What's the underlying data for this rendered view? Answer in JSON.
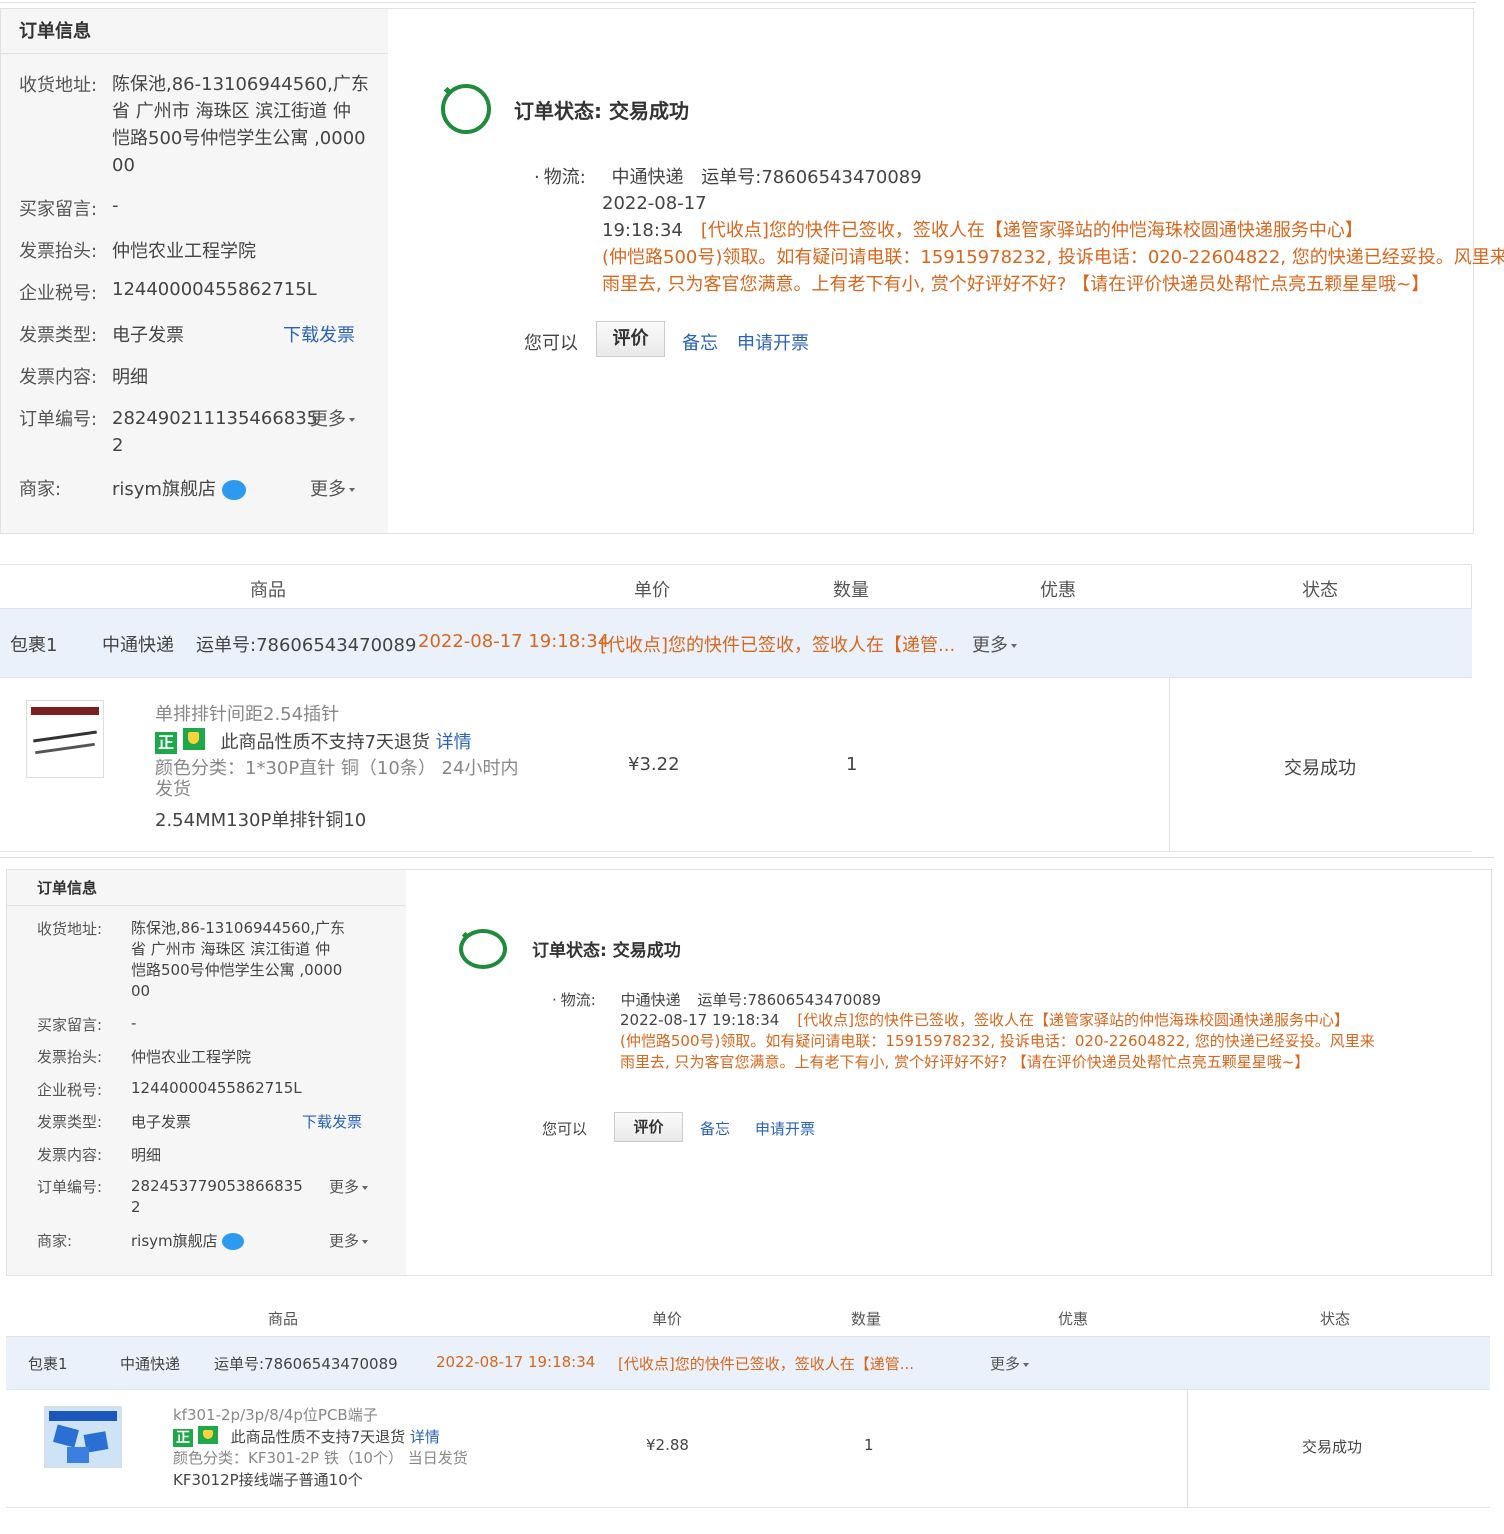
{
  "orders": [
    {
      "info": {
        "title": "订单信息",
        "address_label": "收货地址:",
        "address_lines": [
          "陈保池,86-13106944560,广东",
          "省 广州市 海珠区 滨江街道 仲",
          "恺路500号仲恺学生公寓 ,0000",
          "00"
        ],
        "message_label": "买家留言:",
        "message": "-",
        "invoice_title_label": "发票抬头:",
        "invoice_title": "仲恺农业工程学院",
        "tax_label": "企业税号:",
        "tax_no": "12440000455862715L",
        "invoice_type_label": "发票类型:",
        "invoice_type": "电子发票",
        "download_invoice": "下载发票",
        "invoice_content_label": "发票内容:",
        "invoice_content": "明细",
        "order_no_label": "订单编号:",
        "order_no_lines": [
          "28249021113546683​5",
          "2"
        ],
        "more": "更多",
        "seller_label": "商家:",
        "seller": "risym旗舰店"
      },
      "status": {
        "title": "订单状态: 交易成功",
        "logistics_label": "物流:",
        "carrier": "中通快递",
        "waybill": "运单号:78606543470089",
        "time": "2022-08-17 19:18:34",
        "msg_lines": [
          "[代收点]您的快件已签收，签收人在【递管家驿站的仲恺海珠校圆通快递服务中心】",
          "(仲恺路500号)领取。如有疑问请电联：15915978232, 投诉电话：020-22604822, 您的快递已经妥投。风里来",
          "雨里去, 只为客官您满意。上有老下有小, 赏个好评好不好? 【请在评价快递员处帮忙点亮五颗星星哦~】"
        ],
        "you_can": "您可以",
        "btn_eval": "评价",
        "memo": "备忘",
        "apply_invoice": "申请开票"
      },
      "table": {
        "col_goods": "商品",
        "col_price": "单价",
        "col_qty": "数量",
        "col_discount": "优惠",
        "col_status": "状态",
        "pkg_label": "包裹1",
        "pkg_carrier": "中通快递",
        "pkg_waybill": "运单号:78606543470089",
        "pkg_time": "2022-08-17 19:18:34",
        "pkg_msg": "[代收点]您的快件已签收，签收人在【递管...",
        "pkg_more": "更多",
        "item_name": "单排排针间距2.54插针",
        "badge_zheng": "正",
        "no_return": "此商品性质不支持7天退货",
        "detail": "详情",
        "sku_lines": [
          "颜色分类：1*30P直针 铜（10条）  24小时内",
          "发货"
        ],
        "sku_extra": "2.54MM130P单排针铜10",
        "price": "¥3.22",
        "qty": "1",
        "item_status": "交易成功"
      }
    },
    {
      "info": {
        "title": "订单信息",
        "address_label": "收货地址:",
        "address_lines": [
          "陈保池,86-13106944560,广东",
          "省 广州市 海珠区 滨江街道 仲",
          "恺路500号仲恺学生公寓 ,0000",
          "00"
        ],
        "message_label": "买家留言:",
        "message": "-",
        "invoice_title_label": "发票抬头:",
        "invoice_title": "仲恺农业工程学院",
        "tax_label": "企业税号:",
        "tax_no": "12440000455862715L",
        "invoice_type_label": "发票类型:",
        "invoice_type": "电子发票",
        "download_invoice": "下载发票",
        "invoice_content_label": "发票内容:",
        "invoice_content": "明细",
        "order_no_label": "订单编号:",
        "order_no_lines": [
          "282453779053866835",
          "2"
        ],
        "more": "更多",
        "seller_label": "商家:",
        "seller": "risym旗舰店"
      },
      "status": {
        "title": "订单状态: 交易成功",
        "logistics_label": "物流:",
        "carrier": "中通快递",
        "waybill": "运单号:78606543470089",
        "time": "2022-08-17 19:18:34",
        "msg_lines": [
          "[代收点]您的快件已签收，签收人在【递管家驿站的仲恺海珠校圆通快递服务中心】",
          "(仲恺路500号)领取。如有疑问请电联：15915978232, 投诉电话：020-22604822, 您的快递已经妥投。风里来",
          "雨里去, 只为客官您满意。上有老下有小, 赏个好评好不好? 【请在评价快递员处帮忙点亮五颗星星哦~】"
        ],
        "you_can": "您可以",
        "btn_eval": "评价",
        "memo": "备忘",
        "apply_invoice": "申请开票"
      },
      "table": {
        "col_goods": "商品",
        "col_price": "单价",
        "col_qty": "数量",
        "col_discount": "优惠",
        "col_status": "状态",
        "pkg_label": "包裹1",
        "pkg_carrier": "中通快递",
        "pkg_waybill": "运单号:78606543470089",
        "pkg_time": "2022-08-17 19:18:34",
        "pkg_msg": "[代收点]您的快件已签收，签收人在【递管...",
        "pkg_more": "更多",
        "item_name": "kf301-2p/3p/8/4p位PCB端子",
        "badge_zheng": "正",
        "no_return": "此商品性质不支持7天退货",
        "detail": "详情",
        "sku_lines": [
          "颜色分类：KF301-2P 铁（10个）  当日发货"
        ],
        "sku_extra": "KF3012P接线端子普通10个",
        "price": "¥2.88",
        "qty": "1",
        "item_status": "交易成功"
      }
    }
  ]
}
